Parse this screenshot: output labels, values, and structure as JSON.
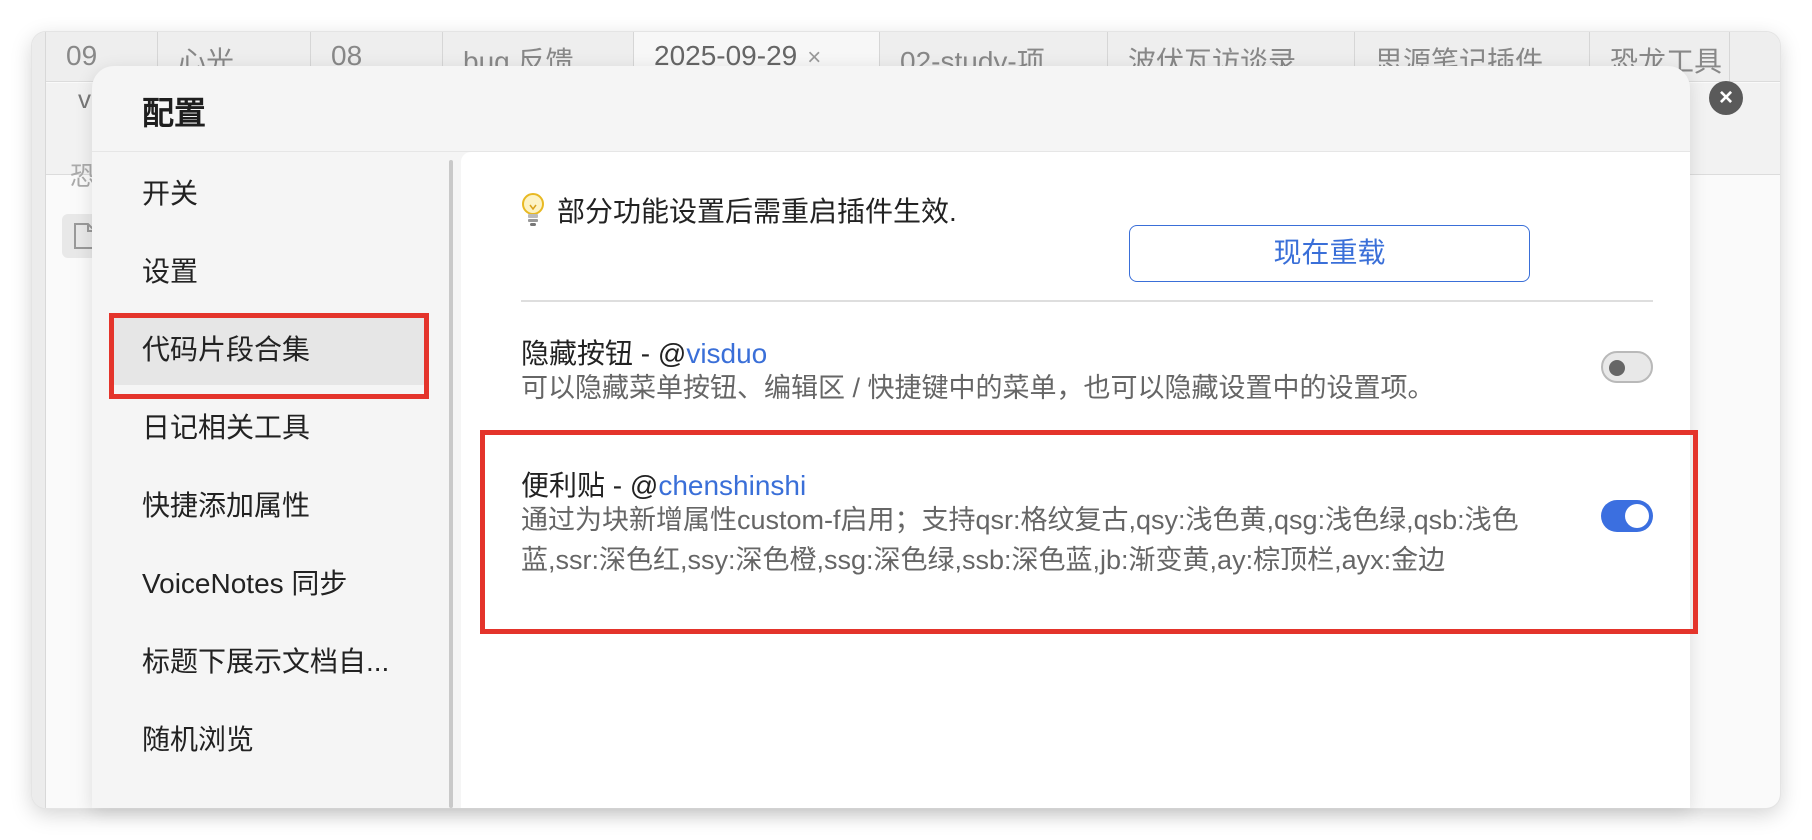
{
  "tabs": [
    {
      "label": "09"
    },
    {
      "label": "心光"
    },
    {
      "label": "08"
    },
    {
      "label": "bug 反馈"
    },
    {
      "label": "2025-09-29",
      "close": "×"
    },
    {
      "label": "02-study-项"
    },
    {
      "label": "波伏瓦访谈录"
    },
    {
      "label": "思源笔记插件"
    },
    {
      "label": "恐龙工具"
    }
  ],
  "background": {
    "row2_label": "v",
    "under_label": "恐"
  },
  "dialog": {
    "title": "配置",
    "close_icon": "close-icon"
  },
  "sidebar": {
    "items": [
      {
        "label": "开关"
      },
      {
        "label": "设置"
      },
      {
        "label": "代码片段合集",
        "active": true
      },
      {
        "label": "日记相关工具"
      },
      {
        "label": "快捷添加属性"
      },
      {
        "label": "VoiceNotes 同步"
      },
      {
        "label": "标题下展示文档自..."
      },
      {
        "label": "随机浏览"
      }
    ]
  },
  "content": {
    "notice_icon": "lightbulb-icon",
    "notice_text": "部分功能设置后需重启插件生效.",
    "reload_button": "现在重载",
    "settings": [
      {
        "title": "隐藏按钮 - @",
        "author": "visduo",
        "description": "可以隐藏菜单按钮、编辑区 / 快捷键中的菜单，也可以隐藏设置中的设置项。",
        "enabled": false
      },
      {
        "title": "便利贴 - @",
        "author": "chenshinshi",
        "description": "通过为块新增属性custom-f启用；支持qsr:格纹复古,qsy:浅色黄,qsg:浅色绿,qsb:浅色蓝,ssr:深色红,ssy:深色橙,ssg:深色绿,ssb:深色蓝,jb:渐变黄,ay:棕顶栏,ayx:金边",
        "enabled": true
      }
    ]
  },
  "colors": {
    "accent": "#3b6fe0",
    "highlight": "#e4342b"
  }
}
